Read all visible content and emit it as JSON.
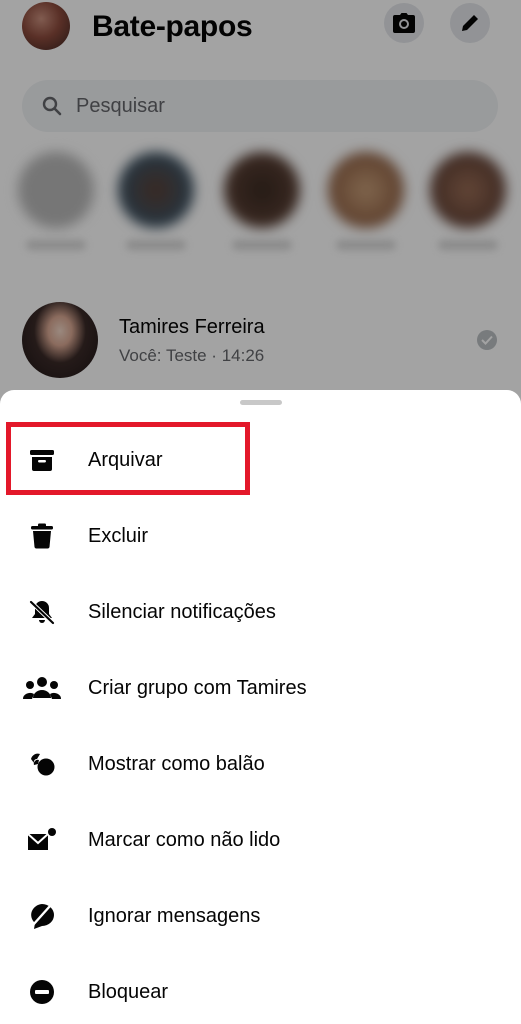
{
  "header": {
    "title": "Bate-papos"
  },
  "search": {
    "placeholder": "Pesquisar"
  },
  "chat": {
    "name": "Tamires Ferreira",
    "preview": "Você: Teste · 14:26"
  },
  "menu": {
    "items": [
      {
        "label": "Arquivar",
        "icon": "archive-icon"
      },
      {
        "label": "Excluir",
        "icon": "trash-icon"
      },
      {
        "label": "Silenciar notificações",
        "icon": "bell-off-icon"
      },
      {
        "label": "Criar grupo com Tamires",
        "icon": "group-icon"
      },
      {
        "label": "Mostrar como balão",
        "icon": "bubble-icon"
      },
      {
        "label": "Marcar como não lido",
        "icon": "unread-mail-icon"
      },
      {
        "label": "Ignorar mensagens",
        "icon": "ignore-icon"
      },
      {
        "label": "Bloquear",
        "icon": "block-icon"
      }
    ]
  },
  "colors": {
    "highlight": "#e3182a",
    "secondary_text": "#65676b"
  }
}
